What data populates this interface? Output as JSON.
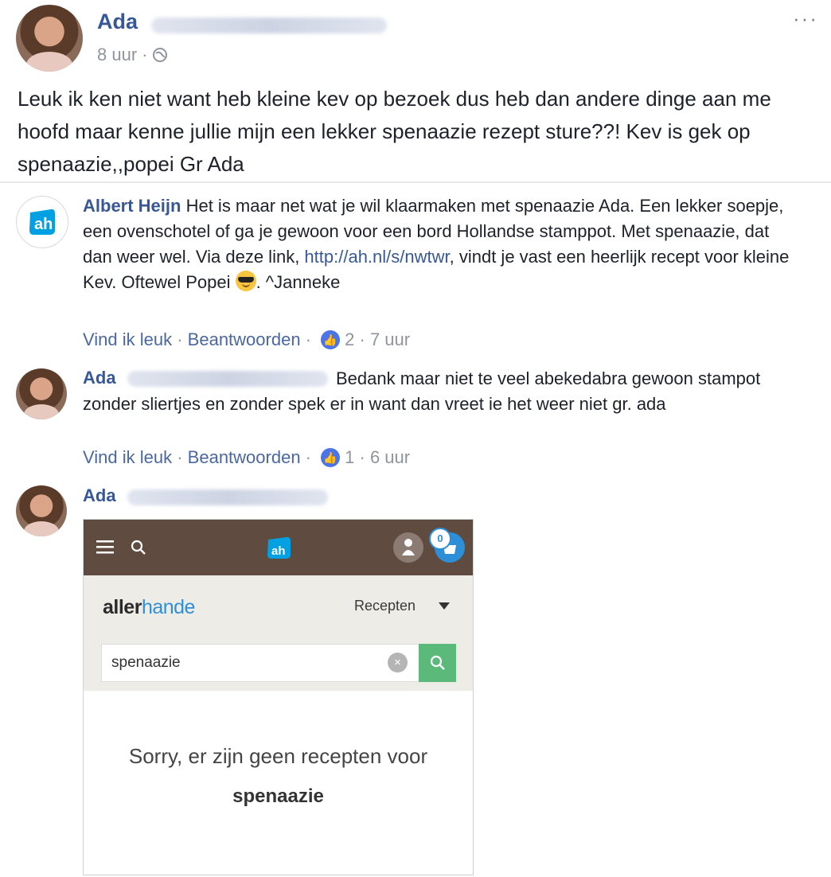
{
  "post": {
    "author": "Ada",
    "time": "8 uur",
    "dot": "·",
    "text": "Leuk ik ken niet want heb kleine kev op bezoek dus heb dan andere dinge aan me hoofd maar kenne jullie mijn een lekker spenaazie rezept sture??! Kev is gek op spenaazie,,popei Gr Ada",
    "more": "···"
  },
  "comments": [
    {
      "author": "Albert Heijn",
      "text_1": " Het is maar net wat je wil klaarmaken met spenaazie Ada. Een lekker soepje, een ovenschotel of ga je gewoon voor een bord Hollandse stamppot. Met spenaazie, dat dan weer wel. Via deze link, ",
      "link": "http://ah.nl/s/nwtwr",
      "text_2": ", vindt je vast een heerlijk recept voor kleine Kev. Oftewel Popei ",
      "text_3": ". ^Janneke",
      "like": "Vind ik leuk",
      "reply": "Beantwoorden",
      "sep": " · ",
      "likes": "2",
      "time": "7 uur"
    },
    {
      "author": "Ada",
      "text": "Bedank maar niet te veel abekedabra gewoon stampot zonder sliertjes en zonder spek er in want dan vreet ie het weer niet gr. ada",
      "like": "Vind ik leuk",
      "reply": "Beantwoorden",
      "sep": " · ",
      "likes": "1",
      "time": "6 uur"
    },
    {
      "author": "Ada"
    }
  ],
  "screenshot": {
    "cart_count": "0",
    "brand_part1": "aller",
    "brand_part2": "hande",
    "menu": "Recepten",
    "search_value": "spenaazie",
    "clear": "×",
    "no_results": "Sorry, er zijn geen recepten voor",
    "term": "spenaazie"
  },
  "colors": {
    "link_name": "#365899",
    "meta": "#90949c",
    "ah_blue": "#00a0e2",
    "header_brown": "#604b40",
    "search_green": "#5bba7a"
  }
}
